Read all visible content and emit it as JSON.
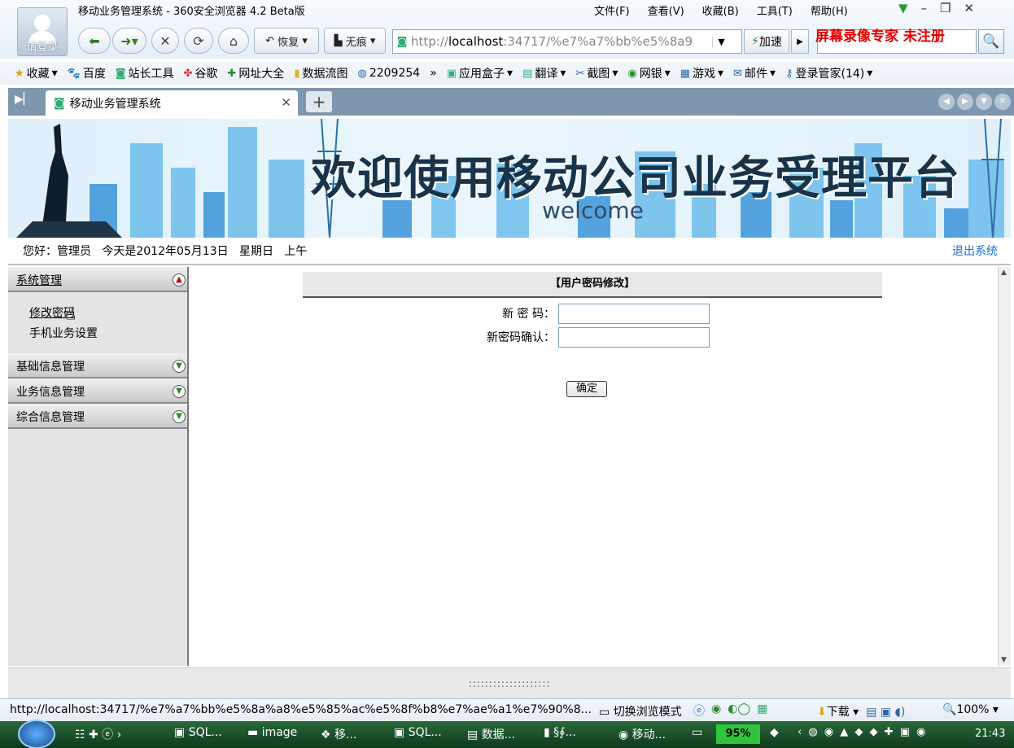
{
  "browser": {
    "avatar_label": "请登录",
    "window_title": "移动业务管理系统 - 360安全浏览器 4.2 Beta版",
    "menu": [
      "文件(F)",
      "查看(V)",
      "收藏(B)",
      "工具(T)",
      "帮助(H)"
    ],
    "nav": {
      "restore_label": "恢复",
      "incognito_label": "无痕",
      "address_prefix": "http://",
      "address_host": "localhost",
      "address_rest": ":34717/%e7%a7%bb%e5%8a9",
      "accelerate_label": "加速"
    },
    "watermark": "屏幕录像专家 未注册",
    "bookmarks": [
      {
        "icon": "star-icon",
        "label": "收藏"
      },
      {
        "icon": "baidu-icon",
        "label": "百度"
      },
      {
        "icon": "page-icon",
        "label": "站长工具"
      },
      {
        "icon": "google-icon",
        "label": "谷歌"
      },
      {
        "icon": "plus-icon",
        "label": "网址大全"
      },
      {
        "icon": "folder-icon",
        "label": "数据流图"
      },
      {
        "icon": "globe-icon",
        "label": "2209254"
      },
      {
        "icon": "more-icon",
        "label": "»"
      },
      {
        "icon": "box-icon",
        "label": "应用盒子"
      },
      {
        "icon": "translate-icon",
        "label": "翻译"
      },
      {
        "icon": "scissors-icon",
        "label": "截图"
      },
      {
        "icon": "bank-icon",
        "label": "网银"
      },
      {
        "icon": "game-icon",
        "label": "游戏"
      },
      {
        "icon": "mail-icon",
        "label": "邮件"
      },
      {
        "icon": "key-icon",
        "label": "登录管家(14)"
      }
    ],
    "tab_title": "移动业务管理系统",
    "status_url": "http://localhost:34717/%e7%a7%bb%e5%8a%a8%e5%85%ac%e5%8f%b8%e7%ae%a1%e7%90%8...",
    "status_mode": "切换浏览模式",
    "status_download": "下载",
    "status_zoom": "100%"
  },
  "page": {
    "banner_title": "欢迎使用移动公司业务受理平台",
    "banner_sub": "welcome",
    "greeting": "您好：管理员   今天是2012年05月13日   星期日   上午",
    "logout": "退出系统",
    "sidebar": {
      "sections": [
        {
          "title": "系统管理",
          "items": [
            "修改密码",
            "手机业务设置"
          ]
        },
        {
          "title": "基础信息管理"
        },
        {
          "title": "业务信息管理"
        },
        {
          "title": "综合信息管理"
        }
      ]
    },
    "form": {
      "header": "【用户密码修改】",
      "new_password_label": "新 密 码：",
      "confirm_label": "新密码确认：",
      "new_password_value": "",
      "confirm_value": "",
      "ok_button": "确定"
    },
    "splitter_dots": "::::::::::::::::::::"
  },
  "taskbar": {
    "tasks": [
      "SQL...",
      "image",
      "移...",
      "SQL...",
      "数据...",
      "§∮...",
      "移动..."
    ],
    "battery": "95%",
    "clock": "21:43"
  }
}
